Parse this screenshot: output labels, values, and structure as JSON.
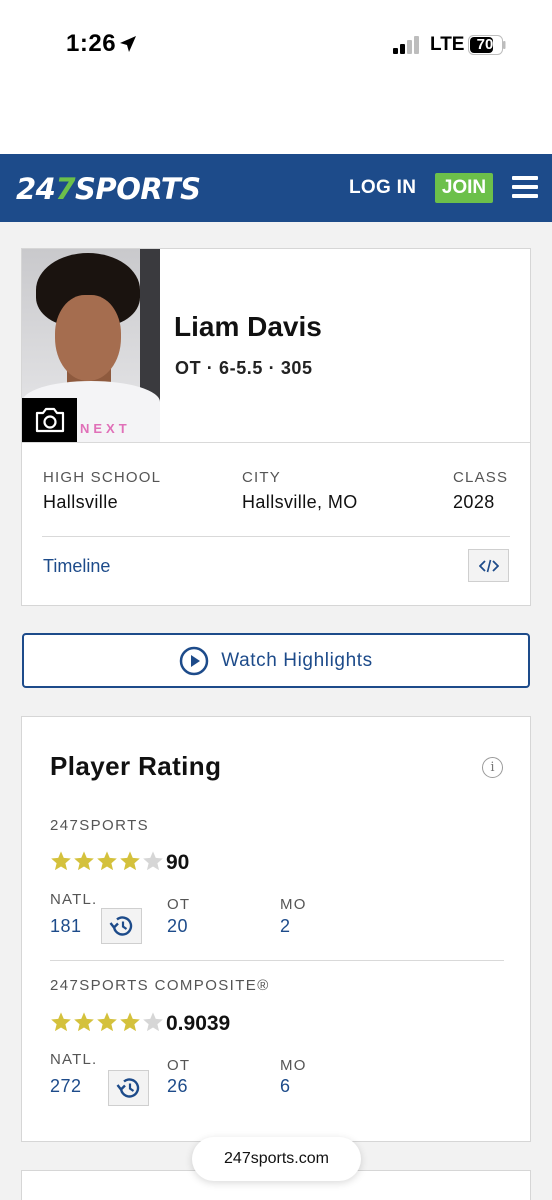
{
  "status_bar": {
    "time": "1:26",
    "carrier": "LTE",
    "battery": "70"
  },
  "header": {
    "logo_prefix": "24",
    "logo_seven": "7",
    "logo_suffix": "SPORTS",
    "login_label": "LOG IN",
    "join_label": "JOIN",
    "brand_color": "#1d4b8a",
    "accent_color": "#6cc04a"
  },
  "player": {
    "name": "Liam Davis",
    "position_line": "OT · 6-5.5 · 305",
    "photo_overlay_text": "NEXT",
    "high_school_label": "HIGH SCHOOL",
    "high_school": "Hallsville",
    "city_label": "CITY",
    "city": "Hallsville, MO",
    "class_label": "CLASS",
    "class_year": "2028",
    "timeline_label": "Timeline"
  },
  "highlights": {
    "label": "Watch Highlights"
  },
  "rating": {
    "title": "Player Rating",
    "sections": [
      {
        "source": "247SPORTS",
        "stars": 4,
        "max_stars": 5,
        "score": "90",
        "natl_label": "NATL.",
        "natl": "181",
        "pos_label": "OT",
        "pos_rank": "20",
        "state_label": "MO",
        "state_rank": "2"
      },
      {
        "source": "247SPORTS COMPOSITE®",
        "stars": 4,
        "max_stars": 5,
        "score": "0.9039",
        "natl_label": "NATL.",
        "natl": "272",
        "pos_label": "OT",
        "pos_rank": "26",
        "state_label": "MO",
        "state_rank": "6"
      }
    ]
  },
  "browser": {
    "url": "247sports.com"
  }
}
